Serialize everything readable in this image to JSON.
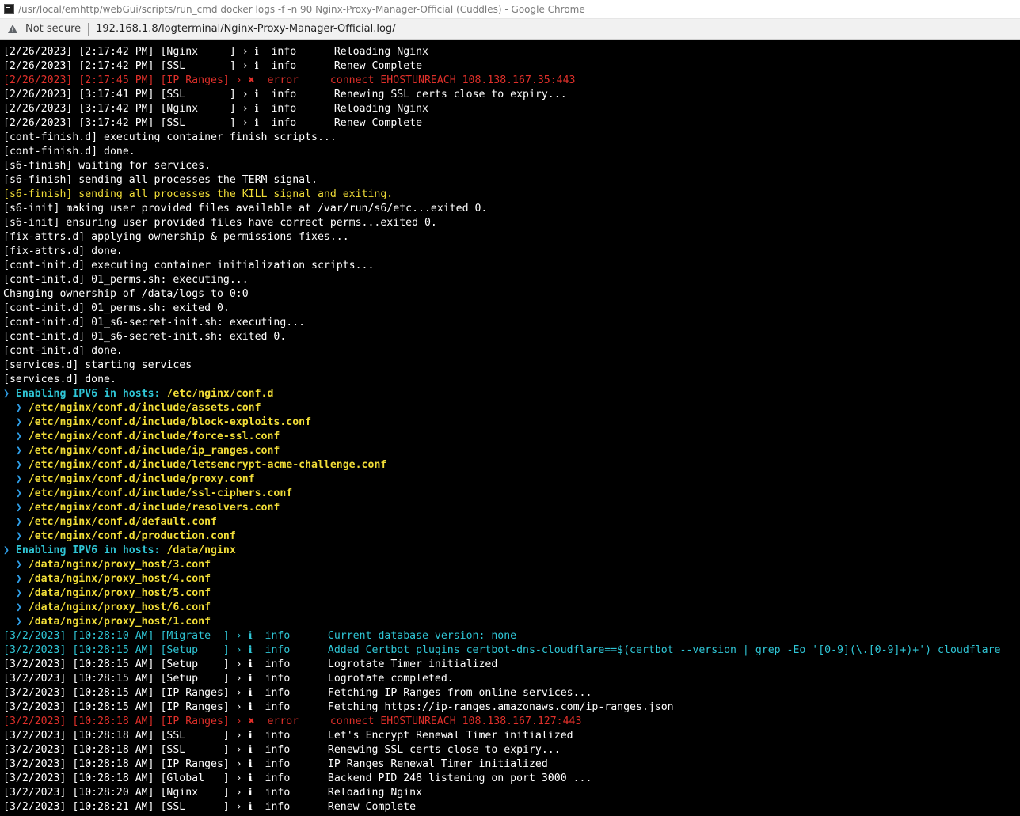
{
  "window": {
    "title": "/usr/local/emhttp/webGui/scripts/run_cmd docker logs -f -n 90 Nginx-Proxy-Manager-Official (Cuddles) - Google Chrome"
  },
  "addressbar": {
    "security_label": "Not secure",
    "url": "192.168.1.8/logterminal/Nginx-Proxy-Manager-Official.log/"
  },
  "colors": {
    "background": "#000000",
    "text": "#ffffff",
    "error": "#e0302a",
    "warning_yellow": "#f1dd38",
    "cyan": "#2fc6d6",
    "chevron_blue": "#2f9fe8"
  },
  "terminal": {
    "lines": [
      {
        "segments": [
          {
            "t": "[2/26/2023] [2:17:42 PM] [Nginx     ] › ℹ  info      Reloading Nginx",
            "c": "c-white"
          }
        ]
      },
      {
        "segments": [
          {
            "t": "[2/26/2023] [2:17:42 PM] [SSL       ] › ℹ  info      Renew Complete",
            "c": "c-white"
          }
        ]
      },
      {
        "segments": [
          {
            "t": "[2/26/2023] [2:17:45 PM] [IP Ranges] › ✖  error     connect EHOSTUNREACH 108.138.167.35:443",
            "c": "c-red"
          }
        ]
      },
      {
        "segments": [
          {
            "t": "[2/26/2023] [3:17:41 PM] [SSL       ] › ℹ  info      Renewing SSL certs close to expiry...",
            "c": "c-white"
          }
        ]
      },
      {
        "segments": [
          {
            "t": "[2/26/2023] [3:17:42 PM] [Nginx     ] › ℹ  info      Reloading Nginx",
            "c": "c-white"
          }
        ]
      },
      {
        "segments": [
          {
            "t": "[2/26/2023] [3:17:42 PM] [SSL       ] › ℹ  info      Renew Complete",
            "c": "c-white"
          }
        ]
      },
      {
        "segments": [
          {
            "t": "[cont-finish.d] executing container finish scripts...",
            "c": "c-white"
          }
        ]
      },
      {
        "segments": [
          {
            "t": "[cont-finish.d] done.",
            "c": "c-white"
          }
        ]
      },
      {
        "segments": [
          {
            "t": "[s6-finish] waiting for services.",
            "c": "c-white"
          }
        ]
      },
      {
        "segments": [
          {
            "t": "[s6-finish] sending all processes the TERM signal.",
            "c": "c-white"
          }
        ]
      },
      {
        "segments": [
          {
            "t": "[s6-finish] sending all processes the KILL signal and exiting.",
            "c": "c-yellow"
          }
        ]
      },
      {
        "segments": [
          {
            "t": "[s6-init] making user provided files available at /var/run/s6/etc...exited 0.",
            "c": "c-white"
          }
        ]
      },
      {
        "segments": [
          {
            "t": "[s6-init] ensuring user provided files have correct perms...exited 0.",
            "c": "c-white"
          }
        ]
      },
      {
        "segments": [
          {
            "t": "[fix-attrs.d] applying ownership & permissions fixes...",
            "c": "c-white"
          }
        ]
      },
      {
        "segments": [
          {
            "t": "[fix-attrs.d] done.",
            "c": "c-white"
          }
        ]
      },
      {
        "segments": [
          {
            "t": "[cont-init.d] executing container initialization scripts...",
            "c": "c-white"
          }
        ]
      },
      {
        "segments": [
          {
            "t": "[cont-init.d] 01_perms.sh: executing...",
            "c": "c-white"
          }
        ]
      },
      {
        "segments": [
          {
            "t": "Changing ownership of /data/logs to 0:0",
            "c": "c-white"
          }
        ]
      },
      {
        "segments": [
          {
            "t": "[cont-init.d] 01_perms.sh: exited 0.",
            "c": "c-white"
          }
        ]
      },
      {
        "segments": [
          {
            "t": "[cont-init.d] 01_s6-secret-init.sh: executing...",
            "c": "c-white"
          }
        ]
      },
      {
        "segments": [
          {
            "t": "[cont-init.d] 01_s6-secret-init.sh: exited 0.",
            "c": "c-white"
          }
        ]
      },
      {
        "segments": [
          {
            "t": "[cont-init.d] done.",
            "c": "c-white"
          }
        ]
      },
      {
        "segments": [
          {
            "t": "[services.d] starting services",
            "c": "c-white"
          }
        ]
      },
      {
        "segments": [
          {
            "t": "[services.d] done.",
            "c": "c-white"
          }
        ]
      },
      {
        "segments": [
          {
            "t": "❯ ",
            "c": "c-arrow bold"
          },
          {
            "t": "Enabling IPV6 in hosts: ",
            "c": "c-cyan bold"
          },
          {
            "t": "/etc/nginx/conf.d",
            "c": "c-yellow bold"
          }
        ]
      },
      {
        "segments": [
          {
            "t": "  ❯ ",
            "c": "c-arrow bold"
          },
          {
            "t": "/etc/nginx/conf.d/include/assets.conf",
            "c": "c-yellow bold"
          }
        ]
      },
      {
        "segments": [
          {
            "t": "  ❯ ",
            "c": "c-arrow bold"
          },
          {
            "t": "/etc/nginx/conf.d/include/block-exploits.conf",
            "c": "c-yellow bold"
          }
        ]
      },
      {
        "segments": [
          {
            "t": "  ❯ ",
            "c": "c-arrow bold"
          },
          {
            "t": "/etc/nginx/conf.d/include/force-ssl.conf",
            "c": "c-yellow bold"
          }
        ]
      },
      {
        "segments": [
          {
            "t": "  ❯ ",
            "c": "c-arrow bold"
          },
          {
            "t": "/etc/nginx/conf.d/include/ip_ranges.conf",
            "c": "c-yellow bold"
          }
        ]
      },
      {
        "segments": [
          {
            "t": "  ❯ ",
            "c": "c-arrow bold"
          },
          {
            "t": "/etc/nginx/conf.d/include/letsencrypt-acme-challenge.conf",
            "c": "c-yellow bold"
          }
        ]
      },
      {
        "segments": [
          {
            "t": "  ❯ ",
            "c": "c-arrow bold"
          },
          {
            "t": "/etc/nginx/conf.d/include/proxy.conf",
            "c": "c-yellow bold"
          }
        ]
      },
      {
        "segments": [
          {
            "t": "  ❯ ",
            "c": "c-arrow bold"
          },
          {
            "t": "/etc/nginx/conf.d/include/ssl-ciphers.conf",
            "c": "c-yellow bold"
          }
        ]
      },
      {
        "segments": [
          {
            "t": "  ❯ ",
            "c": "c-arrow bold"
          },
          {
            "t": "/etc/nginx/conf.d/include/resolvers.conf",
            "c": "c-yellow bold"
          }
        ]
      },
      {
        "segments": [
          {
            "t": "  ❯ ",
            "c": "c-arrow bold"
          },
          {
            "t": "/etc/nginx/conf.d/default.conf",
            "c": "c-yellow bold"
          }
        ]
      },
      {
        "segments": [
          {
            "t": "  ❯ ",
            "c": "c-arrow bold"
          },
          {
            "t": "/etc/nginx/conf.d/production.conf",
            "c": "c-yellow bold"
          }
        ]
      },
      {
        "segments": [
          {
            "t": "❯ ",
            "c": "c-arrow bold"
          },
          {
            "t": "Enabling IPV6 in hosts: ",
            "c": "c-cyan bold"
          },
          {
            "t": "/data/nginx",
            "c": "c-yellow bold"
          }
        ]
      },
      {
        "segments": [
          {
            "t": "  ❯ ",
            "c": "c-arrow bold"
          },
          {
            "t": "/data/nginx/proxy_host/3.conf",
            "c": "c-yellow bold"
          }
        ]
      },
      {
        "segments": [
          {
            "t": "  ❯ ",
            "c": "c-arrow bold"
          },
          {
            "t": "/data/nginx/proxy_host/4.conf",
            "c": "c-yellow bold"
          }
        ]
      },
      {
        "segments": [
          {
            "t": "  ❯ ",
            "c": "c-arrow bold"
          },
          {
            "t": "/data/nginx/proxy_host/5.conf",
            "c": "c-yellow bold"
          }
        ]
      },
      {
        "segments": [
          {
            "t": "  ❯ ",
            "c": "c-arrow bold"
          },
          {
            "t": "/data/nginx/proxy_host/6.conf",
            "c": "c-yellow bold"
          }
        ]
      },
      {
        "segments": [
          {
            "t": "  ❯ ",
            "c": "c-arrow bold"
          },
          {
            "t": "/data/nginx/proxy_host/1.conf",
            "c": "c-yellow bold"
          }
        ]
      },
      {
        "segments": [
          {
            "t": "[3/2/2023] [10:28:10 AM] [Migrate  ] › ℹ  info      Current database version: none",
            "c": "c-cyan"
          }
        ]
      },
      {
        "segments": [
          {
            "t": "[3/2/2023] [10:28:15 AM] [Setup    ] › ℹ  info      Added Certbot plugins certbot-dns-cloudflare==$(certbot --version | grep -Eo '[0-9](\\.[0-9]+)+') cloudflare",
            "c": "c-cyan"
          }
        ]
      },
      {
        "segments": [
          {
            "t": "[3/2/2023] [10:28:15 AM] [Setup    ] › ℹ  info      Logrotate Timer initialized",
            "c": "c-white"
          }
        ]
      },
      {
        "segments": [
          {
            "t": "[3/2/2023] [10:28:15 AM] [Setup    ] › ℹ  info      Logrotate completed.",
            "c": "c-white"
          }
        ]
      },
      {
        "segments": [
          {
            "t": "[3/2/2023] [10:28:15 AM] [IP Ranges] › ℹ  info      Fetching IP Ranges from online services...",
            "c": "c-white"
          }
        ]
      },
      {
        "segments": [
          {
            "t": "[3/2/2023] [10:28:15 AM] [IP Ranges] › ℹ  info      Fetching https://ip-ranges.amazonaws.com/ip-ranges.json",
            "c": "c-white"
          }
        ]
      },
      {
        "segments": [
          {
            "t": "[3/2/2023] [10:28:18 AM] [IP Ranges] › ✖  error     connect EHOSTUNREACH 108.138.167.127:443",
            "c": "c-red"
          }
        ]
      },
      {
        "segments": [
          {
            "t": "[3/2/2023] [10:28:18 AM] [SSL      ] › ℹ  info      Let's Encrypt Renewal Timer initialized",
            "c": "c-white"
          }
        ]
      },
      {
        "segments": [
          {
            "t": "[3/2/2023] [10:28:18 AM] [SSL      ] › ℹ  info      Renewing SSL certs close to expiry...",
            "c": "c-white"
          }
        ]
      },
      {
        "segments": [
          {
            "t": "[3/2/2023] [10:28:18 AM] [IP Ranges] › ℹ  info      IP Ranges Renewal Timer initialized",
            "c": "c-white"
          }
        ]
      },
      {
        "segments": [
          {
            "t": "[3/2/2023] [10:28:18 AM] [Global   ] › ℹ  info      Backend PID 248 listening on port 3000 ...",
            "c": "c-white"
          }
        ]
      },
      {
        "segments": [
          {
            "t": "[3/2/2023] [10:28:20 AM] [Nginx    ] › ℹ  info      Reloading Nginx",
            "c": "c-white"
          }
        ]
      },
      {
        "segments": [
          {
            "t": "[3/2/2023] [10:28:21 AM] [SSL      ] › ℹ  info      Renew Complete",
            "c": "c-white"
          }
        ]
      }
    ]
  }
}
